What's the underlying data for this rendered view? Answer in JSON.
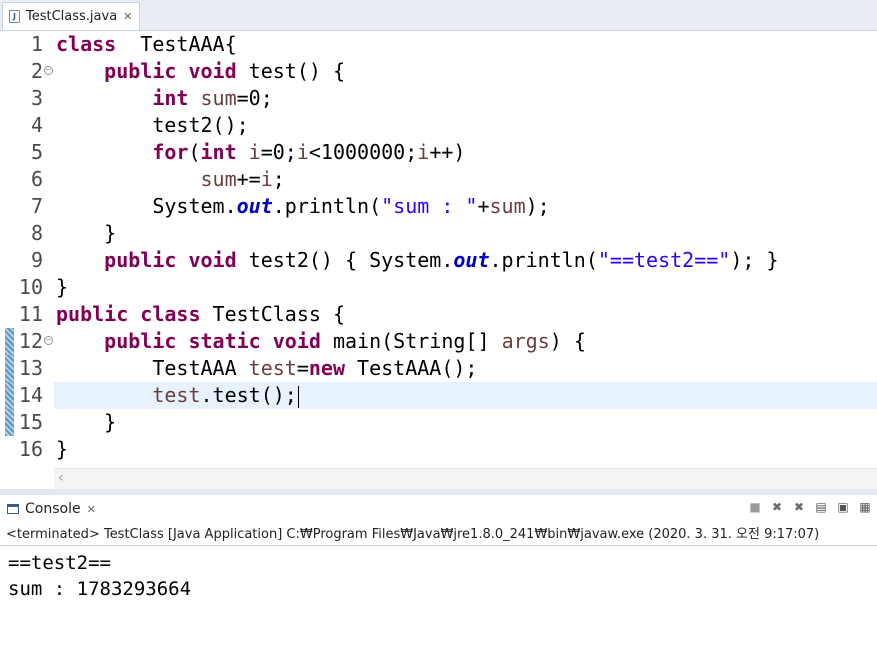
{
  "editor": {
    "tab": {
      "label": "TestClass.java",
      "icon": "java-file-icon",
      "close_glyph": "✕"
    },
    "lines": [
      {
        "n": "1",
        "t": [
          [
            "kw",
            "class"
          ],
          [
            "",
            "  TestAAA{"
          ]
        ]
      },
      {
        "n": "2",
        "fold": true,
        "t": [
          [
            "",
            "    "
          ],
          [
            "kw",
            "public"
          ],
          [
            "",
            " "
          ],
          [
            "kw",
            "void"
          ],
          [
            "",
            " test() {"
          ]
        ]
      },
      {
        "n": "3",
        "t": [
          [
            "",
            "        "
          ],
          [
            "kw",
            "int"
          ],
          [
            "",
            " "
          ],
          [
            "var",
            "sum"
          ],
          [
            "",
            "=0;"
          ]
        ]
      },
      {
        "n": "4",
        "t": [
          [
            "",
            "        test2();"
          ]
        ]
      },
      {
        "n": "5",
        "t": [
          [
            "",
            "        "
          ],
          [
            "kw",
            "for"
          ],
          [
            "",
            "("
          ],
          [
            "kw",
            "int"
          ],
          [
            "",
            " "
          ],
          [
            "var",
            "i"
          ],
          [
            "",
            "=0;"
          ],
          [
            "var",
            "i"
          ],
          [
            "",
            "<1000000;"
          ],
          [
            "var",
            "i"
          ],
          [
            "",
            "++)"
          ]
        ]
      },
      {
        "n": "6",
        "t": [
          [
            "",
            "            "
          ],
          [
            "var",
            "sum"
          ],
          [
            "",
            "+="
          ],
          [
            "var",
            "i"
          ],
          [
            "",
            ";"
          ]
        ]
      },
      {
        "n": "7",
        "t": [
          [
            "",
            "        System."
          ],
          [
            "fld",
            "out"
          ],
          [
            "",
            ".println("
          ],
          [
            "str",
            "\"sum : \""
          ],
          [
            "",
            "+"
          ],
          [
            "var",
            "sum"
          ],
          [
            "",
            ");"
          ]
        ]
      },
      {
        "n": "8",
        "t": [
          [
            "",
            "    }"
          ]
        ]
      },
      {
        "n": "9",
        "t": [
          [
            "",
            "    "
          ],
          [
            "kw",
            "public"
          ],
          [
            "",
            " "
          ],
          [
            "kw",
            "void"
          ],
          [
            "",
            " test2() { System."
          ],
          [
            "fld",
            "out"
          ],
          [
            "",
            ".println("
          ],
          [
            "str",
            "\"==test2==\""
          ],
          [
            "",
            "); }"
          ]
        ]
      },
      {
        "n": "10",
        "t": [
          [
            "",
            "}"
          ]
        ]
      },
      {
        "n": "11",
        "t": [
          [
            "kw",
            "public"
          ],
          [
            "",
            " "
          ],
          [
            "kw",
            "class"
          ],
          [
            "",
            " TestClass {"
          ]
        ]
      },
      {
        "n": "12",
        "fold": true,
        "changed": true,
        "t": [
          [
            "",
            "    "
          ],
          [
            "kw",
            "public"
          ],
          [
            "",
            " "
          ],
          [
            "kw",
            "static"
          ],
          [
            "",
            " "
          ],
          [
            "kw",
            "void"
          ],
          [
            "",
            " main(String[] "
          ],
          [
            "var",
            "args"
          ],
          [
            "",
            ") {"
          ]
        ]
      },
      {
        "n": "13",
        "changed": true,
        "t": [
          [
            "",
            "        TestAAA "
          ],
          [
            "var",
            "test"
          ],
          [
            "",
            "="
          ],
          [
            "kw",
            "new"
          ],
          [
            "",
            " TestAAA();"
          ]
        ]
      },
      {
        "n": "14",
        "changed": true,
        "current": true,
        "caret": true,
        "t": [
          [
            "",
            "        "
          ],
          [
            "var",
            "test"
          ],
          [
            "",
            ".test();"
          ]
        ]
      },
      {
        "n": "15",
        "changed": true,
        "t": [
          [
            "",
            "    }"
          ]
        ]
      },
      {
        "n": "16",
        "t": [
          [
            "",
            "}"
          ]
        ]
      }
    ]
  },
  "console": {
    "tab_label": "Console",
    "close_glyph": "✕",
    "toolbar": [
      {
        "name": "terminate-button",
        "glyph": "■",
        "cls": "stop"
      },
      {
        "name": "remove-launch-button",
        "glyph": "✖",
        "cls": "remove"
      },
      {
        "name": "remove-all-terminated-button",
        "glyph": "✖",
        "cls": "remove"
      },
      {
        "name": "scroll-lock-button",
        "glyph": "▤",
        "cls": ""
      },
      {
        "name": "pin-console-button",
        "glyph": "▣",
        "cls": ""
      },
      {
        "name": "display-selected-console-button",
        "glyph": "▦",
        "cls": ""
      }
    ],
    "status": "<terminated> TestClass [Java Application] C:₩Program Files₩Java₩jre1.8.0_241₩bin₩javaw.exe (2020. 3. 31. 오전 9:17:07)",
    "output": [
      "==test2==",
      "sum : 1783293664"
    ]
  }
}
